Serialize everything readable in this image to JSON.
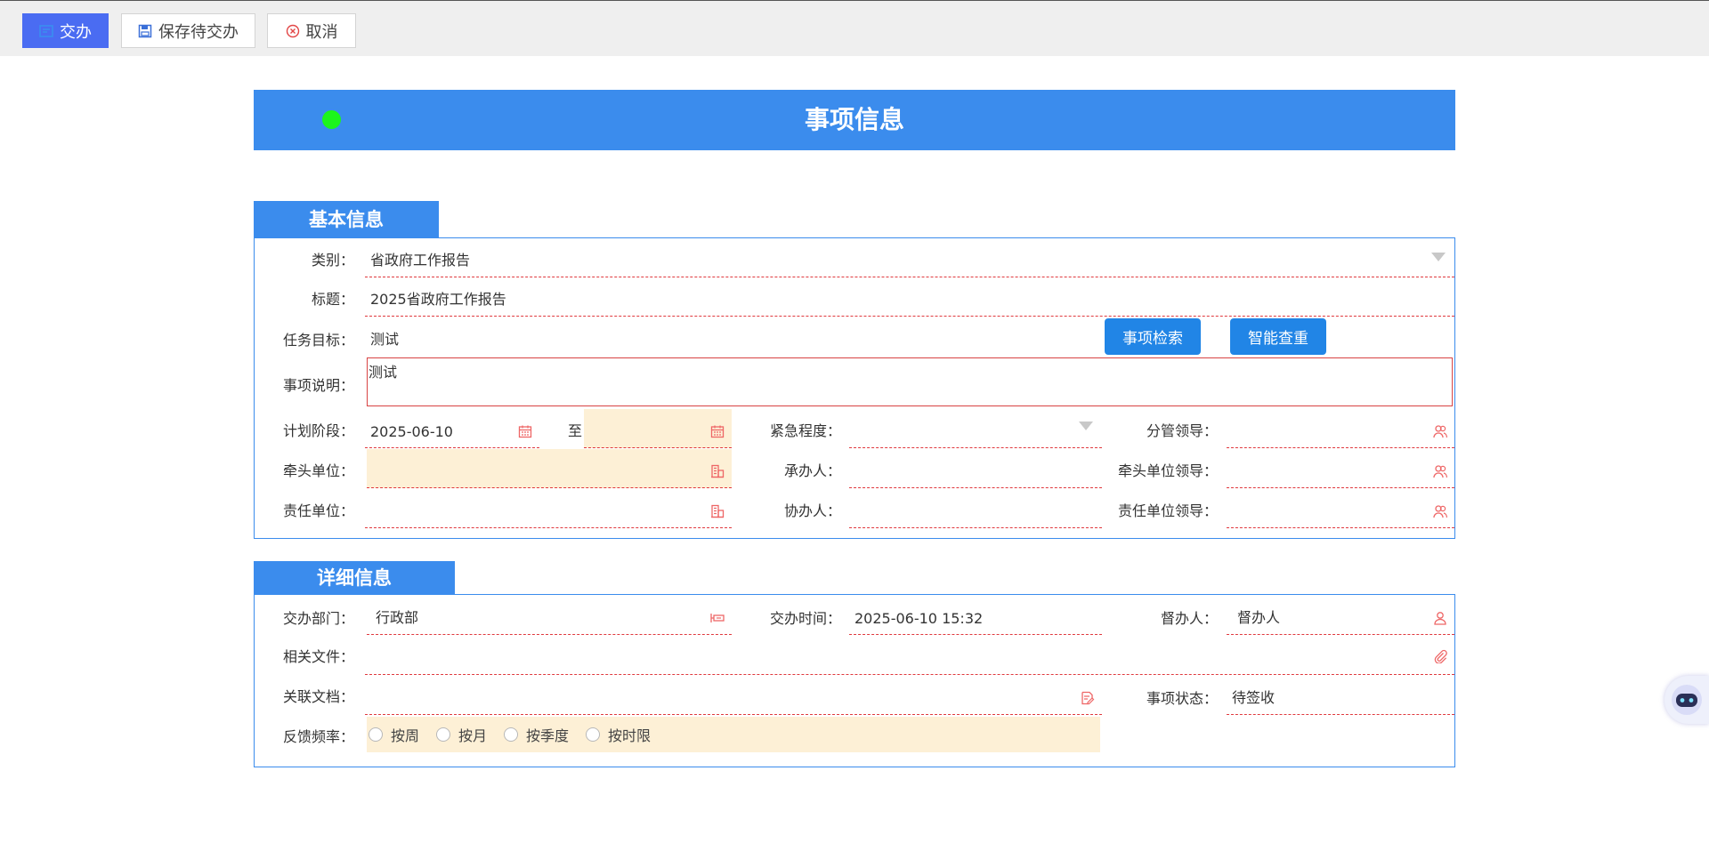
{
  "toolbar": {
    "handover_label": "交办",
    "save_pending_label": "保存待交办",
    "cancel_label": "取消"
  },
  "header": {
    "title": "事项信息"
  },
  "basic": {
    "section_title": "基本信息",
    "category_label": "类别：",
    "category_value": "省政府工作报告",
    "title_label": "标题：",
    "title_value": "2025省政府工作报告",
    "goal_label": "任务目标：",
    "goal_value": "测试",
    "search_button": "事项检索",
    "dedupe_button": "智能查重",
    "desc_label": "事项说明：",
    "desc_value": "测试",
    "plan_label": "计划阶段：",
    "plan_start": "2025-06-10",
    "plan_to": "至",
    "plan_end": "",
    "urgency_label": "紧急程度：",
    "urgency_value": "",
    "supervisor_leader_label": "分管领导：",
    "lead_unit_label": "牵头单位：",
    "handler_label": "承办人：",
    "lead_unit_leader_label": "牵头单位领导：",
    "resp_unit_label": "责任单位：",
    "co_handler_label": "协办人：",
    "resp_unit_leader_label": "责任单位领导："
  },
  "detail": {
    "section_title": "详细信息",
    "dept_label": "交办部门：",
    "dept_value": "行政部",
    "time_label": "交办时间：",
    "time_value": "2025-06-10 15:32",
    "supervisor_label": "督办人：",
    "supervisor_value": "督办人",
    "files_label": "相关文件：",
    "docs_label": "关联文档：",
    "status_label": "事项状态：",
    "status_value": "待签收",
    "freq_label": "反馈频率：",
    "freq_options": [
      "按周",
      "按月",
      "按季度",
      "按时限"
    ]
  },
  "colors": {
    "primary": "#3b8ced",
    "toolbar_primary": "#4a6cf2",
    "dashed": "#e0393e",
    "highlight": "#fdf0d6"
  }
}
